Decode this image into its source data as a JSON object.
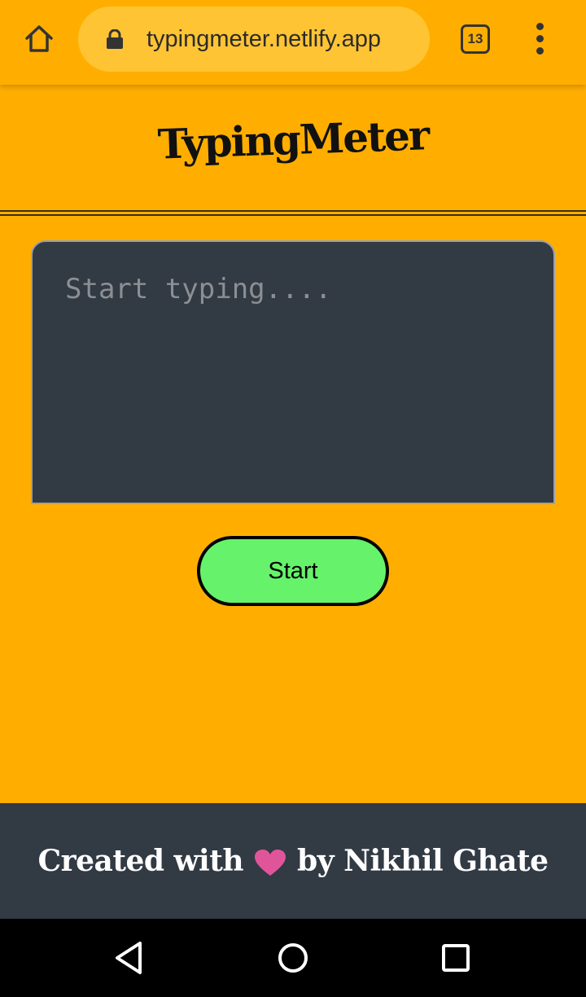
{
  "browser": {
    "url": "typingmeter.netlify.app",
    "tab_count": "13",
    "icons": [
      "home-icon",
      "lock-icon",
      "tabs-icon",
      "overflow-menu-icon"
    ]
  },
  "app": {
    "logo_text": "TypingMeter",
    "typing_placeholder": "Start typing....",
    "start_label": "Start"
  },
  "footer": {
    "created_with": "Created with",
    "by_author": "by Nikhil Ghate",
    "heart_icon": "heart-icon"
  },
  "colors": {
    "page_background": "#FFAE00",
    "url_pill": "#FFC433",
    "typing_area": "#323A44",
    "start_button": "#66F26A",
    "footer_background": "#323A44",
    "heart": "#E0559A"
  },
  "system_nav": {
    "icons": [
      "back-icon",
      "home-circle-icon",
      "recents-icon"
    ]
  }
}
